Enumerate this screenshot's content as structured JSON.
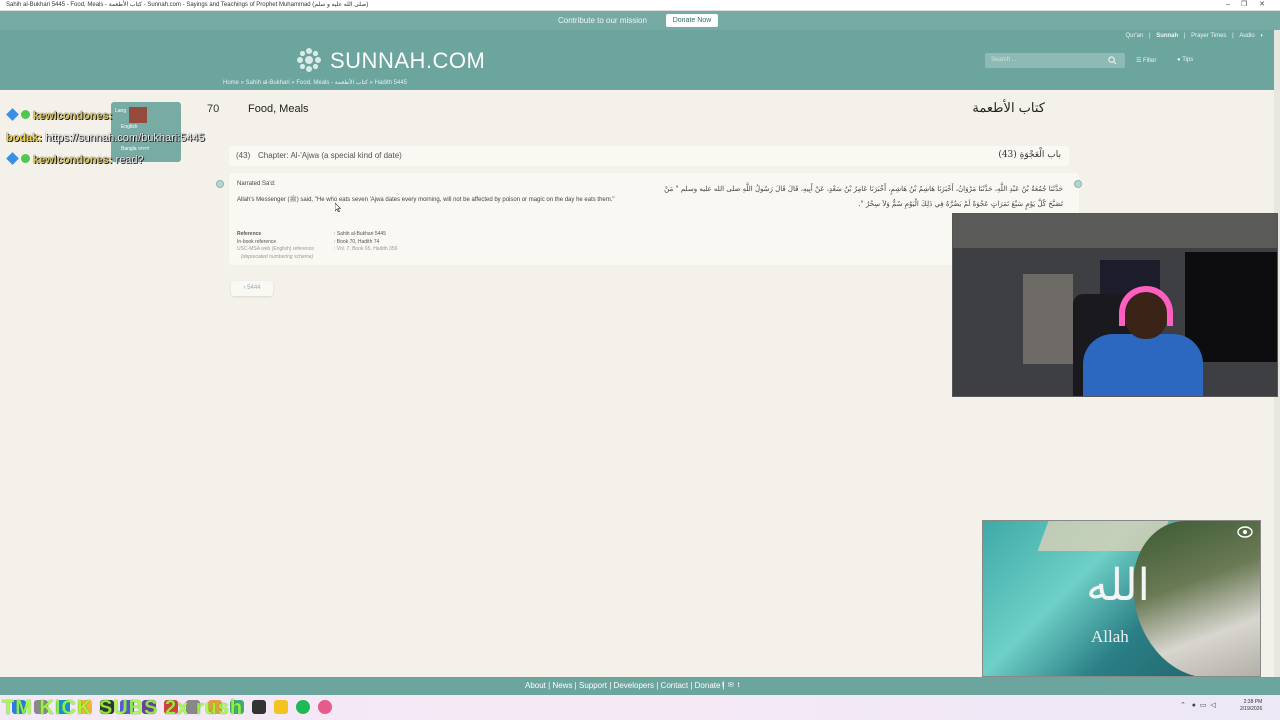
{
  "window": {
    "title": "Sahih al-Bukhari 5445 - Food, Meals - كتاب الأطعمة - Sunnah.com - Sayings and Teachings of Prophet Muhammad (صلى الله عليه و سلم)",
    "controls": [
      "–",
      "❐",
      "✕"
    ]
  },
  "contribute": {
    "message": "Contribute to our mission",
    "button": "Donate Now"
  },
  "header": {
    "top_links": [
      "Qur'an",
      "|",
      "Sunnah",
      "|",
      "Prayer Times",
      "|",
      "Audio"
    ],
    "logo": "SUNNAH.COM",
    "search_placeholder": "Search ...",
    "filter": "Filter",
    "tips": "Tips",
    "breadcrumb": "Home » Sahih al-Bukhari » Food, Meals - كتاب الأطعمة » Hadith 5445"
  },
  "book": {
    "number": "70",
    "title": "Food, Meals",
    "arabic": "كتاب الأطعمة"
  },
  "chapter": {
    "number": "(43)",
    "title": "Chapter: Al-'Ajwa (a special kind of date)",
    "arabic": "(43) باب الْعَجْوَةِ"
  },
  "hadith": {
    "narrated": "Narrated Sa'd:",
    "english": "Allah's Messenger (ﷺ) said, \"He who eats seven 'Ajwa dates every morning, will not be affected by poison or magic on the day he eats them.\"",
    "arabic": "حَدَّثَنَا جُمُعَةُ بْنُ عَبْدِ اللَّهِ، حَدَّثَنَا مَرْوَانُ، أَخْبَرَنَا هَاشِمُ بْنُ هَاشِمٍ، أَخْبَرَنَا عَامِرُ بْنُ سَعْدٍ، عَنْ أَبِيهِ، قَالَ قَالَ رَسُولُ اللَّهِ صلى الله عليه وسلم ‏\"‏ مَنْ تَصَبَّحَ كُلَّ يَوْمٍ سَبْعَ تَمَرَاتٍ عَجْوَةً لَمْ يَضُرَّهُ فِي ذَلِكَ الْيَوْمِ سُمٌّ وَلاَ سِحْرٌ ‏\"‏‏.‏",
    "references": [
      {
        "key": "Reference",
        "value": ": Sahih al-Bukhari 5445"
      },
      {
        "key": "In-book reference",
        "value": ": Book 70, Hadith 74"
      },
      {
        "key": "USC-MSA web (English) reference",
        "value": ": Vol. 7, Book 65, Hadith 356"
      },
      {
        "key": "(deprecated numbering scheme)",
        "value": ""
      }
    ],
    "prev_button": "‹ 5444"
  },
  "overlay": {
    "lang_popup": {
      "option1": "English",
      "option2": "Bangla বাংলা",
      "option_top": "Lang"
    },
    "chat": [
      {
        "user": "kewlcondones:",
        "message": ""
      },
      {
        "user": "bodak:",
        "message": "https://sunnah.com/bukhari:5445"
      },
      {
        "user": "kewlcondones:",
        "message": "read?"
      }
    ],
    "video_word": "Allah",
    "video_calligraphy": "الله"
  },
  "footer": {
    "links": [
      "About",
      "News",
      "Support",
      "Developers",
      "Contact",
      "Donate"
    ],
    "social": [
      "f",
      "✉",
      "t"
    ]
  },
  "taskbar": {
    "banner": "TM KICK SUBS 2x rush",
    "time": "2:38 PM",
    "date": "2/19/2026"
  },
  "colors": {
    "brand_teal": "#6ca49e",
    "background": "#f4f1ea",
    "panel": "#faf8f3"
  }
}
